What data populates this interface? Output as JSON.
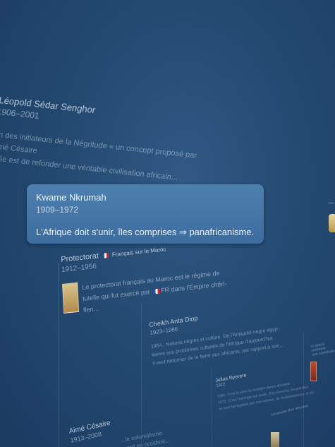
{
  "entries": {
    "senghor": {
      "name": "Léopold Sédar Senghor",
      "years": "1906–2001",
      "body": [
        "Un des initiateurs de la Négritude « un concept proposé par",
        "Aimé Césaire",
        "l'idée est de refonder une véritable civilisation africain..."
      ]
    },
    "nkrumah": {
      "name": "Kwame Nkrumah",
      "years": "1909–1972",
      "quote": "L'Afrique doit s'unir, îles comprises ⇒ panafricanisme."
    },
    "protectorat": {
      "name": "Protectorat",
      "subtitle": "Français sur le Maroc",
      "years": "1912–1956",
      "body": [
        "Le protectorat français au Maroc est le régime de",
        "tutelle qui fut exercé par",
        "FR dans l'Empire chéri-",
        "fien..."
      ]
    },
    "diop": {
      "name": "Cheikh Anta Diop",
      "years": "1923–1986",
      "body": [
        "1954 : Nations nègres et culture. De l'Antiquité nègre égyp-",
        "tienne aux problèmes culturels de l'Afrique d'aujourd'hui.",
        "Il veut redonner de la fierté aux africains, par rapport à son..."
      ]
    },
    "cesaire": {
      "name": "Aimé Césaire",
      "years": "1913–2008",
      "body": [
        "...le colonialisme",
        "...ard en occident..."
      ]
    },
    "nyerere": {
      "name": "Julius Nyerere",
      "years": "1922",
      "body": [
        "1960 : Il est le père de l'indépendance africaine",
        "1972 : C'est l'exemple est aussi, d'un nouveau Gouverneur",
        "se sont fait égaliser par eux-mêmes, de l'indépendance, et de..."
      ]
    },
    "right_fragment": {
      "lines": [
        "Le grand",
        "continent",
        "une contribution"
      ]
    },
    "bottom_fragment": {
      "label": "Un peuple libre africaine"
    }
  }
}
